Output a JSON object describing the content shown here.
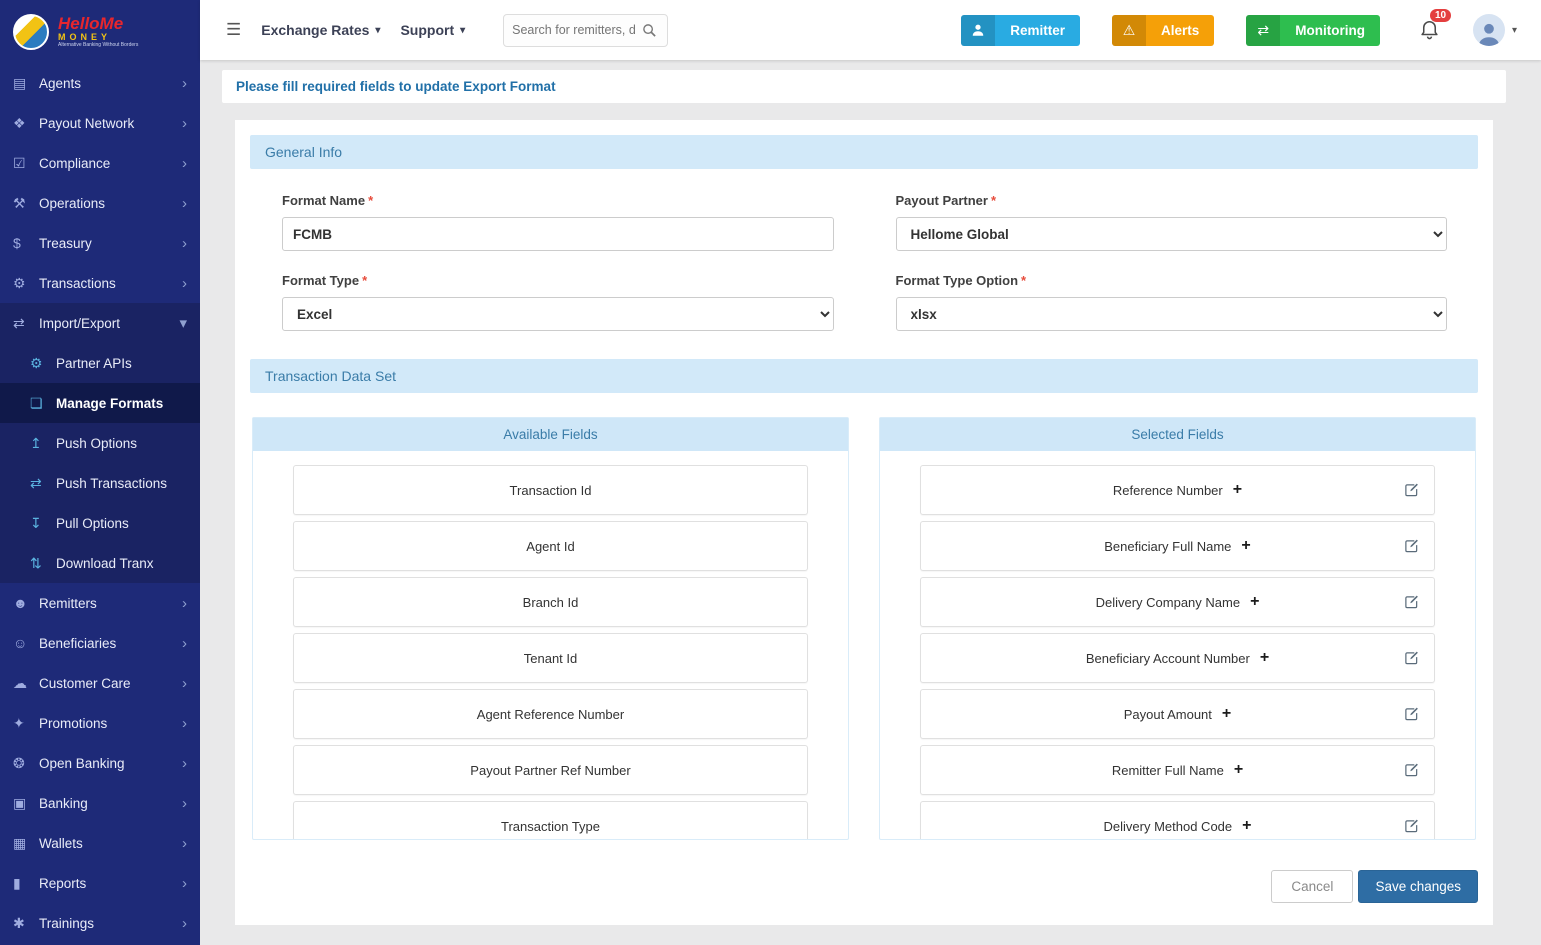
{
  "ui": {
    "required_marker": "*"
  },
  "brand": {
    "line1": "HelloMe",
    "line2": "MONEY",
    "tagline": "Alternative Banking Without Borders"
  },
  "topbar": {
    "menus": [
      {
        "label": "Exchange Rates"
      },
      {
        "label": "Support"
      }
    ],
    "search": {
      "placeholder": "Search for remitters, d"
    },
    "buttons": [
      {
        "label": "Remitter",
        "icon": "user",
        "color": "#29abe2"
      },
      {
        "label": "Alerts",
        "icon": "warning",
        "color": "#f5a008"
      },
      {
        "label": "Monitoring",
        "icon": "exchange",
        "color": "#2ebe4f"
      }
    ],
    "notifications": {
      "count": "10"
    }
  },
  "sidebar": {
    "items": [
      {
        "label": "Agents",
        "icon": "agents",
        "type": "top"
      },
      {
        "label": "Payout Network",
        "icon": "payout-network",
        "type": "top"
      },
      {
        "label": "Compliance",
        "icon": "compliance",
        "type": "top"
      },
      {
        "label": "Operations",
        "icon": "operations",
        "type": "top"
      },
      {
        "label": "Treasury",
        "icon": "treasury",
        "type": "top"
      },
      {
        "label": "Transactions",
        "icon": "transactions",
        "type": "top"
      },
      {
        "label": "Import/Export",
        "icon": "import-export",
        "type": "top",
        "expanded": true
      },
      {
        "label": "Partner APIs",
        "icon": "partner-apis",
        "type": "sub"
      },
      {
        "label": "Manage Formats",
        "icon": "manage-formats",
        "type": "sub",
        "active": true
      },
      {
        "label": "Push Options",
        "icon": "push-options",
        "type": "sub"
      },
      {
        "label": "Push Transactions",
        "icon": "push-transactions",
        "type": "sub"
      },
      {
        "label": "Pull Options",
        "icon": "pull-options",
        "type": "sub"
      },
      {
        "label": "Download Tranx",
        "icon": "download-tranx",
        "type": "sub"
      },
      {
        "label": "Remitters",
        "icon": "remitters",
        "type": "top"
      },
      {
        "label": "Beneficiaries",
        "icon": "beneficiaries",
        "type": "top"
      },
      {
        "label": "Customer Care",
        "icon": "customer-care",
        "type": "top"
      },
      {
        "label": "Promotions",
        "icon": "promotions",
        "type": "top"
      },
      {
        "label": "Open Banking",
        "icon": "open-banking",
        "type": "top"
      },
      {
        "label": "Banking",
        "icon": "banking",
        "type": "top"
      },
      {
        "label": "Wallets",
        "icon": "wallets",
        "type": "top"
      },
      {
        "label": "Reports",
        "icon": "reports",
        "type": "top"
      },
      {
        "label": "Trainings",
        "icon": "trainings",
        "type": "top"
      }
    ]
  },
  "page": {
    "notice": "Please fill required fields to update Export Format",
    "general_info": {
      "title": "General Info",
      "fields": {
        "format_name": {
          "label": "Format Name",
          "value": "FCMB"
        },
        "payout_partner": {
          "label": "Payout Partner",
          "value": "Hellome Global"
        },
        "format_type": {
          "label": "Format Type",
          "value": "Excel"
        },
        "format_type_option": {
          "label": "Format Type Option",
          "value": "xlsx"
        }
      }
    },
    "transaction_data_set": {
      "title": "Transaction Data Set",
      "available": {
        "title": "Available Fields",
        "items": [
          "Transaction Id",
          "Agent Id",
          "Branch Id",
          "Tenant Id",
          "Agent Reference Number",
          "Payout Partner Ref Number",
          "Transaction Type"
        ]
      },
      "selected": {
        "title": "Selected Fields",
        "items": [
          "Reference Number",
          "Beneficiary Full Name",
          "Delivery Company Name",
          "Beneficiary Account Number",
          "Payout Amount",
          "Remitter Full Name",
          "Delivery Method Code"
        ]
      }
    },
    "footer": {
      "cancel": "Cancel",
      "save": "Save changes"
    }
  },
  "colors": {
    "sidebar": "#1e2a78",
    "accent": "#2e6da4",
    "header_strip": "#d2e9f9",
    "remitter_btn": "#29abe2",
    "alerts_btn": "#f5a008",
    "monitoring_btn": "#2ebe4f",
    "badge": "#e43f3f"
  }
}
